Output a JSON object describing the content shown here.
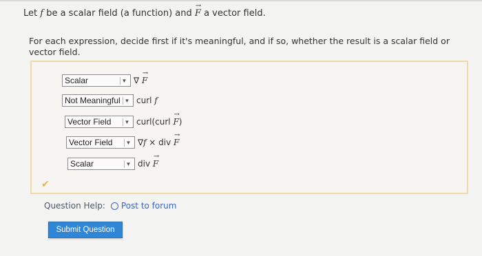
{
  "prompt": {
    "prefix": "Let",
    "f": "f",
    "middle": "be a scalar field (a function) and",
    "F": "F",
    "suffix": "a vector field."
  },
  "instructions": "For each expression, decide first if it's meaningful, and if so, whether the result is a scalar field or vector field.",
  "questions": [
    {
      "selected": "Scalar",
      "expr_parts": [
        "∇ ",
        "F",
        ""
      ]
    },
    {
      "selected": "Not Meaningful",
      "expr_parts": [
        "curl ",
        "f",
        ""
      ]
    },
    {
      "selected": "Vector Field",
      "expr_parts": [
        "curl(curl ",
        "F",
        ")"
      ]
    },
    {
      "selected": "Vector Field",
      "expr_parts": [
        "∇",
        "f",
        " × div "
      ]
    },
    {
      "selected": "Scalar",
      "expr_parts": [
        "div ",
        "F",
        ""
      ]
    }
  ],
  "q4_extra": "F",
  "help": {
    "label": "Question Help:",
    "link": "Post to forum"
  },
  "submit_label": "Submit Question",
  "colors": {
    "accent": "#2f86d6",
    "link": "#3f66b5",
    "box_border": "#f0d8a8"
  }
}
